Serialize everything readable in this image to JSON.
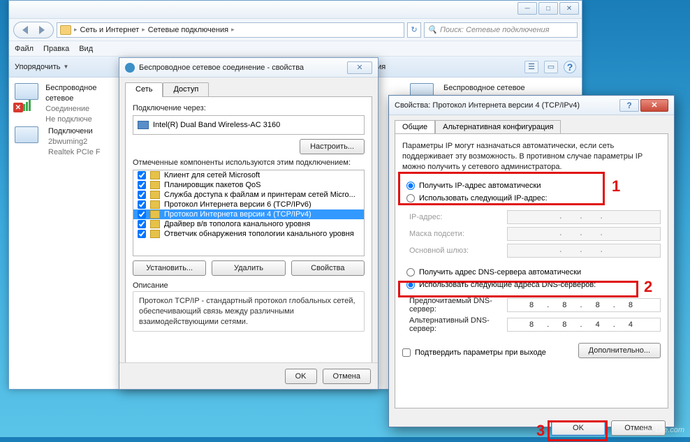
{
  "explorer": {
    "breadcrumb": [
      "Сеть и Интернет",
      "Сетевые подключения"
    ],
    "search_placeholder": "Поиск: Сетевые подключения",
    "menu": [
      "Файл",
      "Правка",
      "Вид"
    ],
    "toolbar": {
      "organize": "Упорядочить",
      "hidden_partial": "ка подключения"
    },
    "connections": [
      {
        "title": "Беспроводное сетевое",
        "line2": "Соединение",
        "line3": "Не подключе",
        "disconnected": true,
        "wifi": true
      },
      {
        "title": "Беспроводное сетевое",
        "line2": "",
        "line3": "",
        "disconnected": false,
        "wifi": false
      },
      {
        "title": "Подключени",
        "line2": "2bwuming2",
        "line3": "Realtek PCIe F",
        "disconnected": false,
        "wifi": false
      }
    ]
  },
  "dlg1": {
    "title": "Беспроводное сетевое соединение - свойства",
    "tabs": [
      "Сеть",
      "Доступ"
    ],
    "connect_via": "Подключение через:",
    "adapter": "Intel(R) Dual Band Wireless-AC 3160",
    "configure": "Настроить...",
    "components_label": "Отмеченные компоненты используются этим подключением:",
    "components": [
      "Клиент для сетей Microsoft",
      "Планировщик пакетов QoS",
      "Служба доступа к файлам и принтерам сетей Micro...",
      "Протокол Интернета версии 6 (TCP/IPv6)",
      "Протокол Интернета версии 4 (TCP/IPv4)",
      "Драйвер в/в тополога канального уровня",
      "Ответчик обнаружения топологии канального уровня"
    ],
    "selected_index": 4,
    "install": "Установить...",
    "uninstall": "Удалить",
    "properties": "Свойства",
    "desc_label": "Описание",
    "desc_text": "Протокол TCP/IP - стандартный протокол глобальных сетей, обеспечивающий связь между различными взаимодействующими сетями.",
    "ok": "OK",
    "cancel": "Отмена"
  },
  "dlg2": {
    "title": "Свойства: Протокол Интернета версии 4 (TCP/IPv4)",
    "tabs": [
      "Общие",
      "Альтернативная конфигурация"
    ],
    "info": "Параметры IP могут назначаться автоматически, если сеть поддерживает эту возможность. В противном случае параметры IP можно получить у сетевого администратора.",
    "r_auto_ip": "Получить IP-адрес автоматически",
    "r_manual_ip": "Использовать следующий IP-адрес:",
    "ip_label": "IP-адрес:",
    "mask_label": "Маска подсети:",
    "gw_label": "Основной шлюз:",
    "r_auto_dns": "Получить адрес DNS-сервера автоматически",
    "r_manual_dns": "Использовать следующие адреса DNS-серверов:",
    "dns1_label": "Предпочитаемый DNS-сервер:",
    "dns2_label": "Альтернативный DNS-сервер:",
    "dns1_value": "8 . 8 . 8 . 8",
    "dns2_value": "8 . 8 . 4 . 4",
    "confirm_chk": "Подтвердить параметры при выходе",
    "advanced": "Дополнительно...",
    "ok": "OK",
    "cancel": "Отмена",
    "callouts": [
      "1",
      "2",
      "3"
    ]
  },
  "watermark": "User-Life.com"
}
